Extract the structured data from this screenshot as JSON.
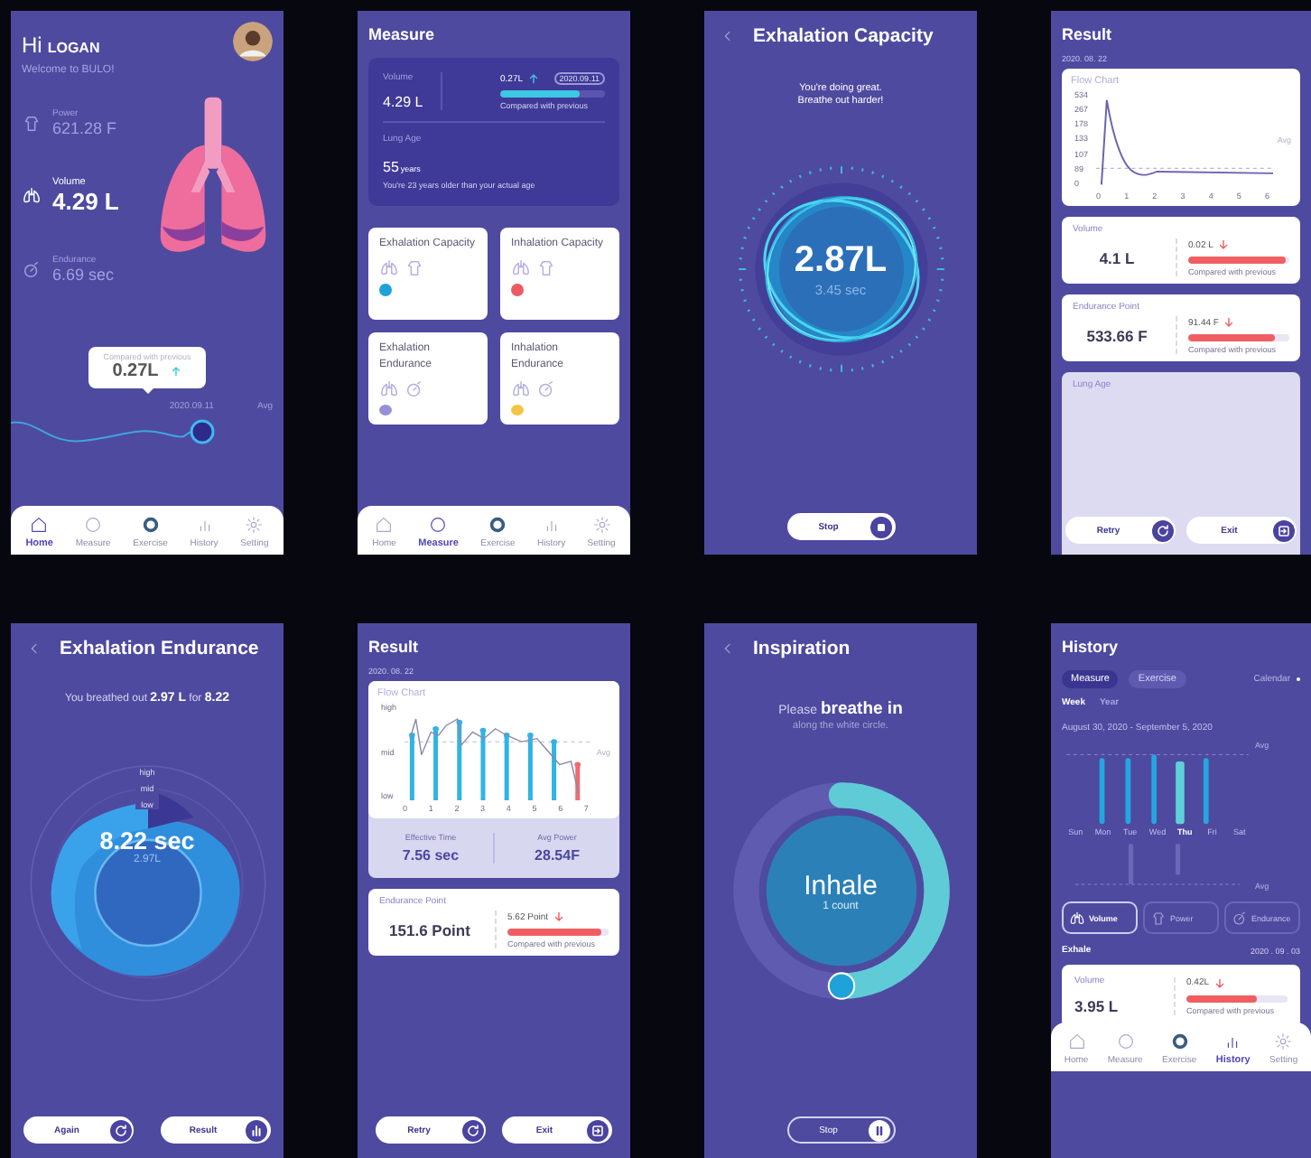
{
  "screens": [
    {
      "kind": "home",
      "greeting": "Hi",
      "user": "LOGAN",
      "subtitle": "Welcome to BULO!",
      "stats": [
        {
          "label": "Power",
          "value": "621.28 F",
          "selected": false
        },
        {
          "label": "Volume",
          "value": "4.29 L",
          "selected": true
        },
        {
          "label": "Endurance",
          "value": "6.69 sec",
          "selected": false
        }
      ],
      "tooltip": {
        "label": "Compared with previous",
        "value": "0.27L",
        "rising": true
      },
      "date": "2020.09.11",
      "avg": "Avg",
      "nav": [
        {
          "label": "Home",
          "selected": true
        },
        {
          "label": "Measure",
          "selected": false
        },
        {
          "label": "Exercise",
          "selected": false
        },
        {
          "label": "History",
          "selected": false
        },
        {
          "label": "Setting",
          "selected": false
        }
      ]
    },
    {
      "kind": "measure",
      "title": "Measure",
      "summary": {
        "label": "Volume",
        "value": "4.29 L",
        "delta": "0.27L",
        "rising": true,
        "date": "2020.09.11",
        "level": 0.75,
        "note": "Compared with previous",
        "age_label": "Lung Age",
        "age": "55",
        "age_unit": "years",
        "age_note": "You're 23 years older than your actual age"
      },
      "cards": [
        {
          "title": "Exhalation Capacity",
          "kind": "capacity",
          "color": "#1ea2d9"
        },
        {
          "title": "Inhalation Capacity",
          "kind": "capacity",
          "color": "#ee5b62"
        },
        {
          "title": "Exhalation Endurance",
          "kind": "endurance",
          "color": "#9591d6"
        },
        {
          "title": "Inhalation Endurance",
          "kind": "endurance",
          "color": "#f4c443"
        }
      ],
      "nav": [
        {
          "label": "Home",
          "selected": false
        },
        {
          "label": "Measure",
          "selected": true
        },
        {
          "label": "Exercise",
          "selected": false
        },
        {
          "label": "History",
          "selected": false
        },
        {
          "label": "Setting",
          "selected": false
        }
      ]
    },
    {
      "kind": "capacity",
      "title": "Exhalation Capacity",
      "message": [
        "You're doing great.",
        "Breathe out harder!"
      ],
      "value": "2.87L",
      "time": "3.45 sec",
      "buttons": [
        {
          "label": "Stop",
          "kind": "stop"
        }
      ]
    },
    {
      "kind": "result",
      "title": "Result",
      "date": "2020. 08. 22",
      "chart": {
        "title": "Flow Chart",
        "y_labels": [
          "534",
          "267",
          "178",
          "133",
          "107",
          "89",
          "0"
        ],
        "x_labels": [
          "0",
          "1",
          "2",
          "3",
          "4",
          "5",
          "6"
        ],
        "avg": "Avg"
      },
      "metrics": [
        {
          "label": "Volume",
          "value": "4.1 L",
          "delta": "0.02 L",
          "rising": false,
          "level": 0.97,
          "note": "Compared with previous"
        },
        {
          "label": "Endurance Point",
          "value": "533.66 F",
          "delta": "91.44 F",
          "rising": false,
          "level": 0.85,
          "note": "Compared with previous"
        }
      ],
      "more": "Lung Age",
      "buttons": [
        {
          "label": "Retry",
          "kind": "repeat"
        },
        {
          "label": "Exit",
          "kind": "leave"
        }
      ]
    },
    {
      "kind": "endurance",
      "title": "Exhalation Endurance",
      "message": "You breathed out **2.97 L** for **8.22**",
      "levels": [
        "high",
        "mid",
        "low"
      ],
      "value": "8.22 sec",
      "sub": "2.97L",
      "buttons": [
        {
          "label": "Again",
          "kind": "repeat"
        },
        {
          "label": "Result",
          "kind": "report"
        }
      ]
    },
    {
      "kind": "result2",
      "title": "Result",
      "date": "2020. 08. 22",
      "chart": {
        "title": "Flow Chart",
        "y_labels": [
          "high",
          "mid",
          "low"
        ],
        "x_labels": [
          "0",
          "1",
          "2",
          "3",
          "4",
          "5",
          "6",
          "7"
        ],
        "avg": "Avg"
      },
      "stats": [
        {
          "label": "Effective Time",
          "value": "7.56 sec"
        },
        {
          "label": "Avg Power",
          "value": "28.54F"
        }
      ],
      "metrics": [
        {
          "label": "Endurance Point",
          "value": "151.6 Point",
          "delta": "5.62 Point",
          "rising": false,
          "level": 0.93,
          "note": "Compared with previous"
        }
      ],
      "buttons": [
        {
          "label": "Retry",
          "kind": "repeat"
        },
        {
          "label": "Exit",
          "kind": "leave"
        }
      ]
    },
    {
      "kind": "inspiration",
      "title": "Inspiration",
      "message": "Please **breathe in**",
      "hint": "along the white circle.",
      "value": "Inhale",
      "sub": "1 count",
      "level": 0.5,
      "buttons": [
        {
          "label": "Stop",
          "kind": "pause"
        }
      ]
    },
    {
      "kind": "history",
      "title": "History",
      "tabs": [
        {
          "label": "Measure",
          "selected": true
        },
        {
          "label": "Exercise",
          "selected": false
        }
      ],
      "calendar": "Calendar",
      "periods": [
        {
          "label": "Week",
          "selected": true
        },
        {
          "label": "Year",
          "selected": false
        }
      ],
      "range": "August 30, 2020 - September 5, 2020",
      "days": [
        {
          "label": "Sun",
          "selected": false
        },
        {
          "label": "Mon",
          "selected": false
        },
        {
          "label": "Tue",
          "selected": false
        },
        {
          "label": "Wed",
          "selected": false
        },
        {
          "label": "Thu",
          "selected": true
        },
        {
          "label": "Fri",
          "selected": false
        },
        {
          "label": "Sat",
          "selected": false
        }
      ],
      "avgs": [
        "Avg",
        "Avg"
      ],
      "metrics": [
        {
          "label": "Volume",
          "selected": true
        },
        {
          "label": "Power",
          "selected": false
        },
        {
          "label": "Endurance",
          "selected": false
        }
      ],
      "section": "Exhale",
      "date": "2020 . 09 . 03",
      "card": {
        "label": "Volume",
        "value": "3.95 L",
        "delta": "0.42L",
        "rising": false,
        "level": 0.7,
        "note": "Compared with previous"
      },
      "nav": [
        {
          "label": "Home",
          "selected": false
        },
        {
          "label": "Measure",
          "selected": false
        },
        {
          "label": "Exercise",
          "selected": false
        },
        {
          "label": "History",
          "selected": true
        },
        {
          "label": "Setting",
          "selected": false
        }
      ]
    }
  ]
}
